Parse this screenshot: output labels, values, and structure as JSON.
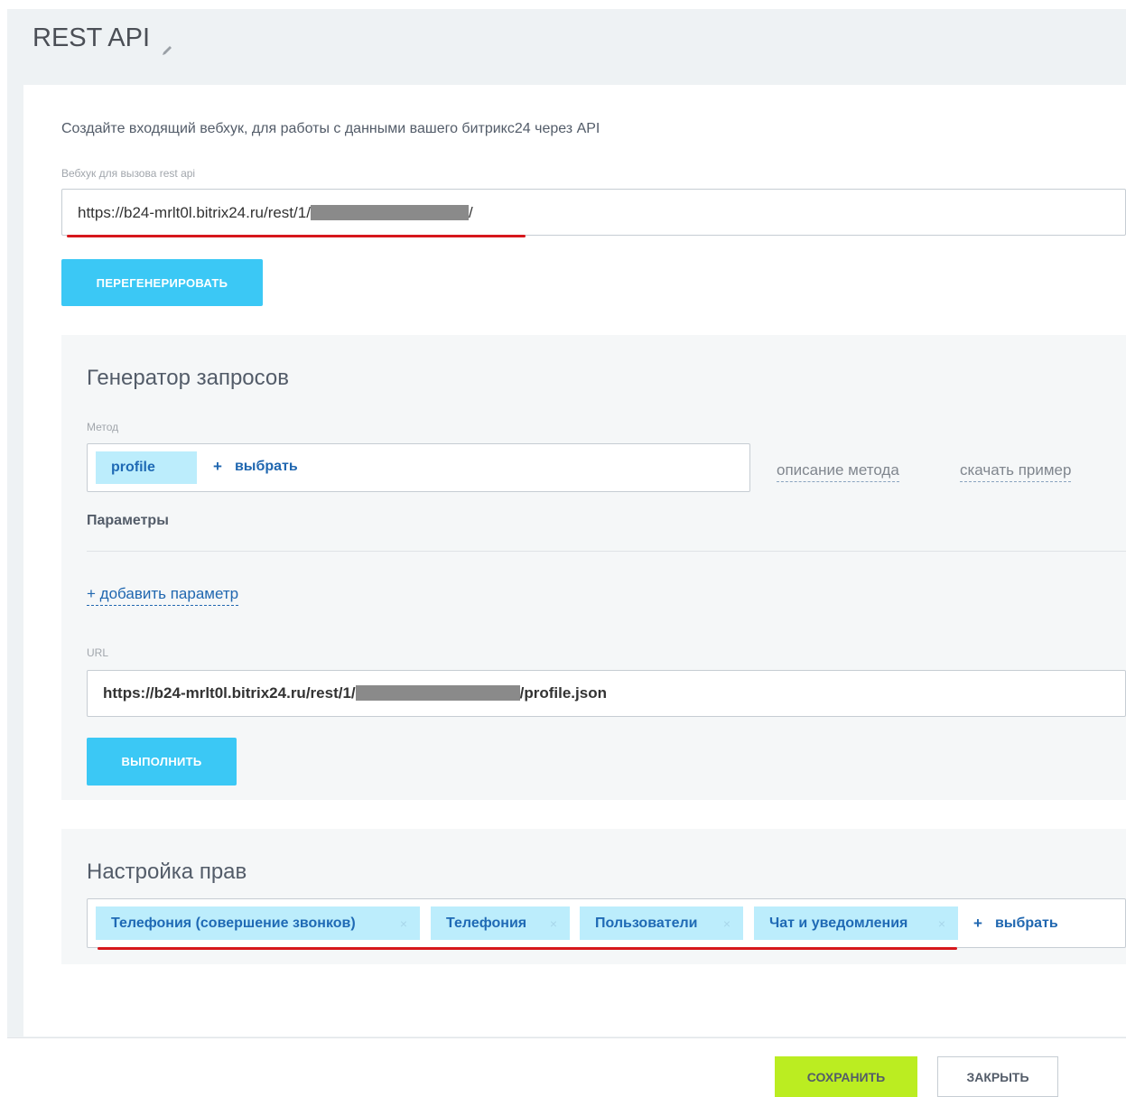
{
  "header": {
    "title": "REST API"
  },
  "webhook": {
    "intro": "Создайте входящий вебхук, для работы с данными вашего битрикс24 через API",
    "field_label": "Вебхук для вызова rest api",
    "url_prefix": "https://b24-mrlt0l.bitrix24.ru/rest/1/",
    "url_suffix": "/",
    "regenerate_label": "ПЕРЕГЕНЕРИРОВАТЬ"
  },
  "generator": {
    "title": "Генератор запросов",
    "method_label": "Метод",
    "method_tag": "profile",
    "choose_label": "выбрать",
    "method_description_link": "описание метода",
    "download_example_link": "скачать пример",
    "params_label": "Параметры",
    "add_param_label": "добавить параметр",
    "url_label": "URL",
    "url_prefix": "https://b24-mrlt0l.bitrix24.ru/rest/1/",
    "url_suffix": "/profile.json",
    "execute_label": "ВЫПОЛНИТЬ"
  },
  "permissions": {
    "title": "Настройка прав",
    "tags": [
      "Телефония (совершение звонков)",
      "Телефония",
      "Пользователи",
      "Чат и уведомления"
    ],
    "choose_label": "выбрать"
  },
  "footer": {
    "save_label": "СОХРАНИТЬ",
    "close_label": "ЗАКРЫТЬ"
  },
  "colors": {
    "accent_blue": "#3bc8f5",
    "save_green": "#bbed21",
    "tag_bg": "#bcedfc",
    "underline_red": "#d6171c"
  }
}
